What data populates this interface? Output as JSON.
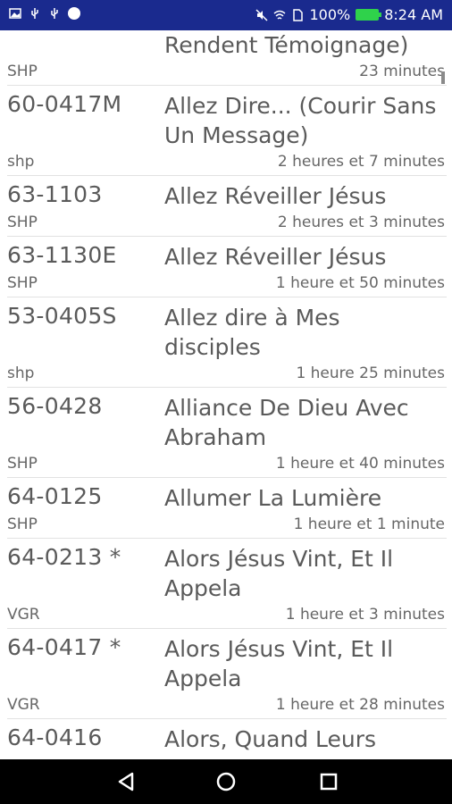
{
  "status_bar": {
    "battery_text": "100%",
    "time": "8:24 AM",
    "icons_left": [
      "image-icon",
      "usb-icon",
      "usb-icon",
      "circle-icon"
    ],
    "icons_right": [
      "mute-icon",
      "wifi-icon",
      "sim-icon",
      "battery-icon"
    ]
  },
  "list": {
    "items": [
      {
        "code": "",
        "title": "Rendent Témoignage)",
        "source": "SHP",
        "duration": "23 minutes"
      },
      {
        "code": "60-0417M",
        "title": "Allez Dire... (Courir Sans\nUn Message)",
        "source": "shp",
        "duration": "2 heures et 7 minutes"
      },
      {
        "code": "63-1103",
        "title": "Allez Réveiller Jésus",
        "source": "SHP",
        "duration": "2 heures et 3 minutes"
      },
      {
        "code": "63-1130E",
        "title": "Allez Réveiller Jésus",
        "source": "SHP",
        "duration": "1 heure et 50 minutes"
      },
      {
        "code": "53-0405S",
        "title": "Allez dire à Mes\ndisciples",
        "source": "shp",
        "duration": "1 heure 25 minutes"
      },
      {
        "code": "56-0428",
        "title": "Alliance De Dieu Avec\nAbraham",
        "source": "SHP",
        "duration": "1 heure et 40 minutes"
      },
      {
        "code": "64-0125",
        "title": "Allumer La Lumière",
        "source": "SHP",
        "duration": "1 heure et 1 minute"
      },
      {
        "code": "64-0213 *",
        "title": "Alors Jésus Vint, Et Il\nAppela",
        "source": "VGR",
        "duration": "1 heure et 3 minutes"
      },
      {
        "code": "64-0417 *",
        "title": "Alors Jésus Vint, Et Il\nAppela",
        "source": "VGR",
        "duration": "1 heure et 28 minutes"
      },
      {
        "code": "64-0416",
        "title": "Alors, Quand Leurs",
        "source": "",
        "duration": ""
      }
    ]
  },
  "colors": {
    "status_bar": "#1a2a8e",
    "nav_bar": "#000000",
    "text": "#5a5a5a"
  }
}
